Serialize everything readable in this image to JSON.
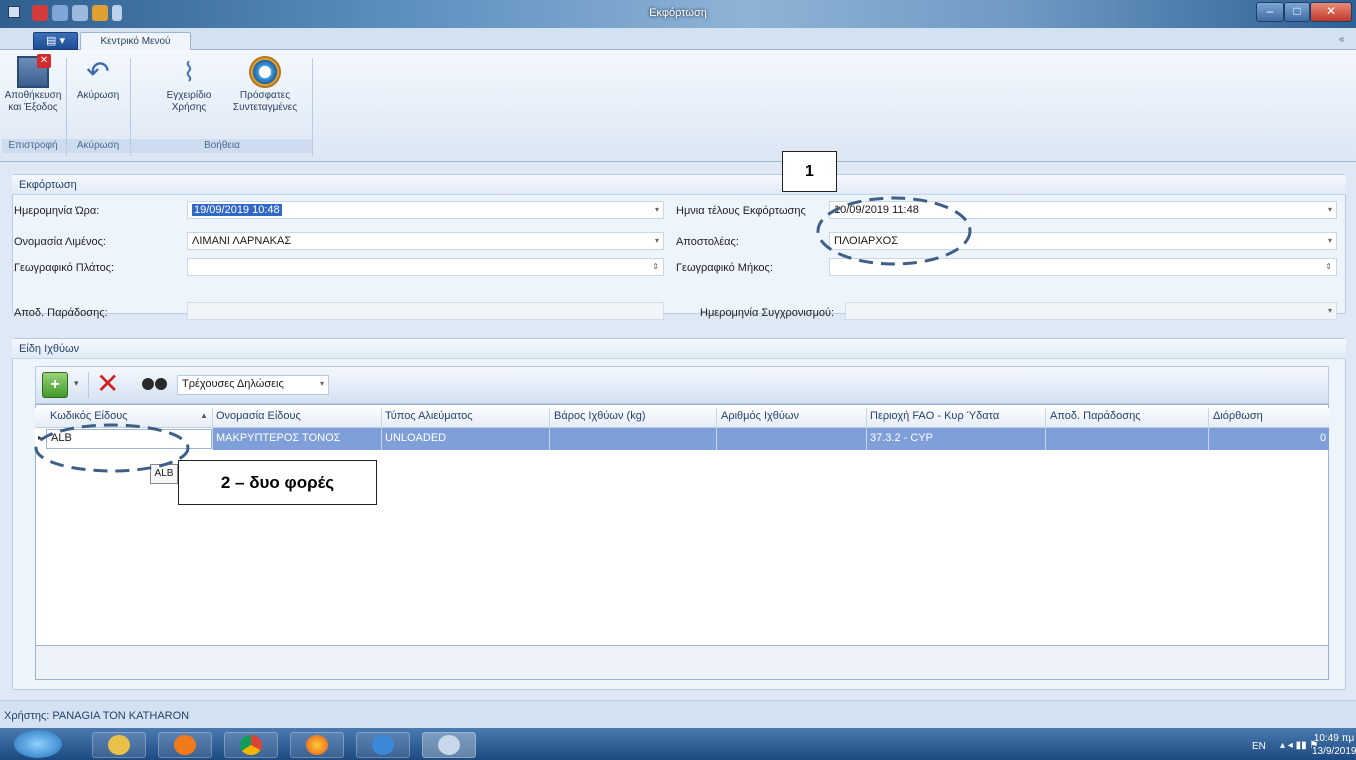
{
  "window": {
    "title": "Εκφόρτωση"
  },
  "ribbon": {
    "app_button": "",
    "tab_main": "Κεντρικό Μενού",
    "buttons": {
      "save_exit": [
        "Αποθήκευση",
        "και Έξοδος"
      ],
      "cancel": "Ακύρωση",
      "manual": [
        "Εγχειρίδιο",
        "Χρήσης"
      ],
      "recent": [
        "Πρόσφατες",
        "Συντεταγμένες"
      ]
    },
    "groups": {
      "return": "Επιστροφή",
      "cancel": "Ακύρωση",
      "help": "Βοήθεια"
    }
  },
  "unloading": {
    "section_title": "Εκφόρτωση",
    "date_time_label": "Ημερομηνία Ώρα:",
    "date_time_value": "19/09/2019 10:48",
    "port_label": "Ονομασία Λιμένος:",
    "port_value": "ΛΙΜΑΝΙ ΛΑΡΝΑΚΑΣ",
    "lat_label": "Γεωγραφικό Πλάτος:",
    "lat_value": "",
    "receipt_label": "Αποδ. Παράδοσης:",
    "receipt_value": "",
    "end_label": "Ημνια τέλους Εκφόρτωσης",
    "end_value": "10/09/2019 11:48",
    "sender_label": "Αποστολέας:",
    "sender_value": "ΠΛΟΙΑΡΧΟΣ",
    "lon_label": "Γεωγραφικό Μήκος:",
    "lon_value": "",
    "sync_label": "Ημερομηνία Συγχρονισμού:",
    "sync_value": ""
  },
  "fish": {
    "section_title": "Είδη Ιχθύων",
    "filter_value": "Τρέχουσες Δηλώσεις",
    "columns": [
      "Κωδικός Είδους",
      "Ονομασία Είδους",
      "Τύπος Αλιεύματος",
      "Βάρος Ιχθύων (kg)",
      "Αριθμός Ιχθύων",
      "Περιοχή FAO - Κυρ Ύδατα",
      "Αποδ. Παράδοσης",
      "Διόρθωση"
    ],
    "row": {
      "code": "ALB",
      "name": "ΜΑΚΡΥΠΤΕΡΟΣ ΤΟΝΟΣ",
      "type": "UNLOADED",
      "weight": "",
      "count": "",
      "area": "37.3.2 - CYP",
      "receipt": "",
      "fix": "0"
    },
    "tooltip": "ALB"
  },
  "status": {
    "user": "Χρήστης: PANAGIA TON KATHARON"
  },
  "callouts": {
    "one": "1",
    "two": "2 – δυο φορές"
  },
  "tray": {
    "lang": "EN",
    "time": "10:49 πμ",
    "date": "13/9/2019"
  },
  "colors": {
    "selection": "#3169c6",
    "row_highlight": "#7f9fd8",
    "dash": "#3e5f86"
  }
}
